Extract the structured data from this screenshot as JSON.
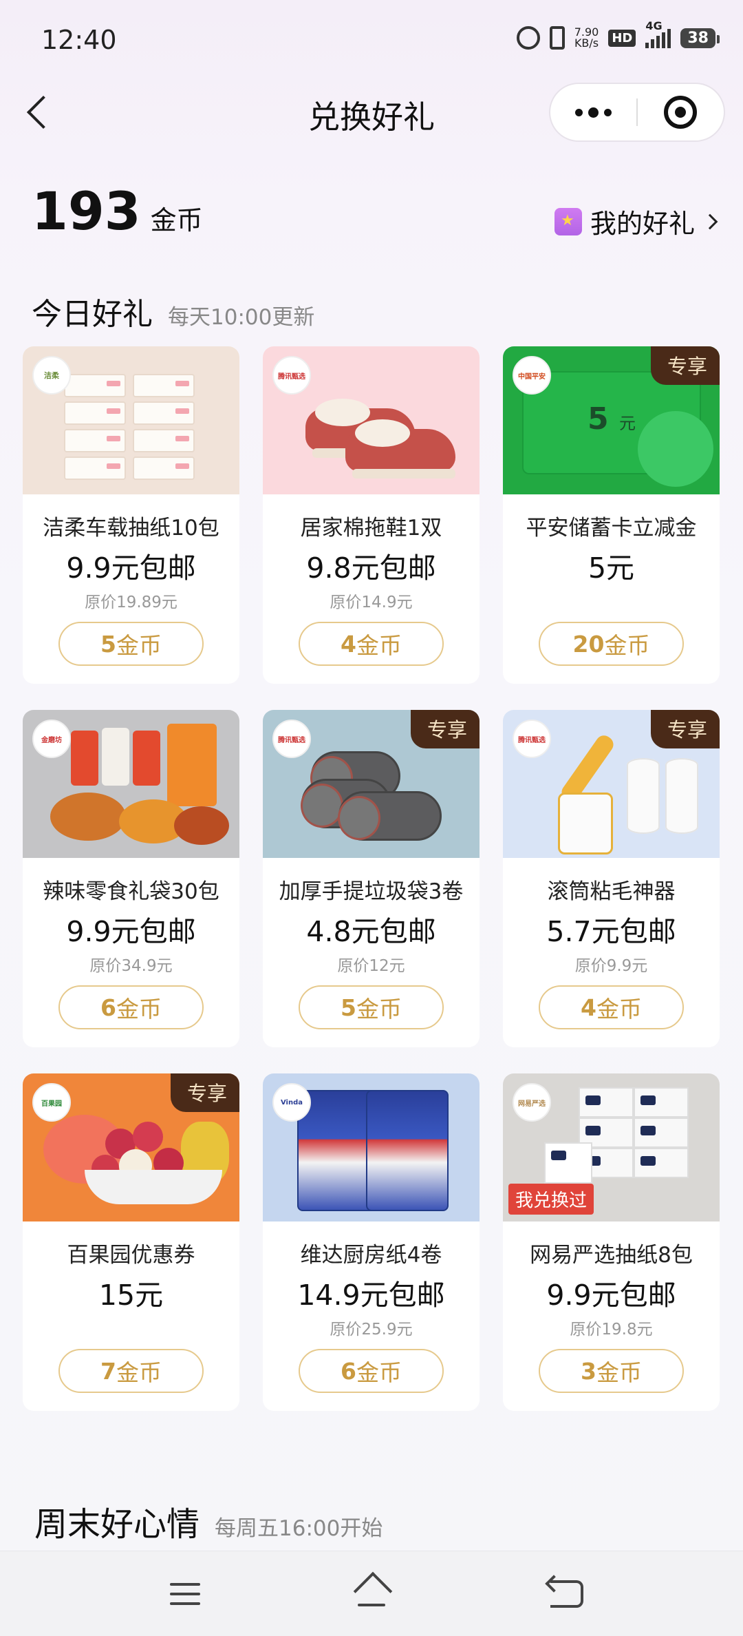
{
  "status_bar": {
    "time": "12:40",
    "speed_value": "7.90",
    "speed_unit": "KB/s",
    "hd": "HD",
    "network": "4G",
    "battery": "38"
  },
  "nav": {
    "title": "兑换好礼"
  },
  "wallet": {
    "coins": "193",
    "coins_unit": "金币",
    "my_gifts_label": "我的好礼"
  },
  "today": {
    "title": "今日好礼",
    "subtitle": "每天10:00更新",
    "items": [
      {
        "name": "洁柔车载抽纸10包",
        "price": "9.9元包邮",
        "original": "原价19.89元",
        "coins": "5",
        "coin_unit": "金币",
        "tag": "",
        "image": "tissue-packs",
        "brand": "洁柔"
      },
      {
        "name": "居家棉拖鞋1双",
        "price": "9.8元包邮",
        "original": "原价14.9元",
        "coins": "4",
        "coin_unit": "金币",
        "tag": "",
        "image": "cotton-slippers",
        "brand": "腾讯甄选"
      },
      {
        "name": "平安储蓄卡立减金",
        "price": "5元",
        "original": "",
        "coins": "20",
        "coin_unit": "金币",
        "tag": "专享",
        "image": "green-coupon-card",
        "brand": "中国平安",
        "card_amount": "5",
        "card_unit": "元"
      },
      {
        "name": "辣味零食礼袋30包",
        "price": "9.9元包邮",
        "original": "原价34.9元",
        "coins": "6",
        "coin_unit": "金币",
        "tag": "",
        "image": "spicy-snacks",
        "brand": "金磨坊"
      },
      {
        "name": "加厚手提垃圾袋3卷",
        "price": "4.8元包邮",
        "original": "原价12元",
        "coins": "5",
        "coin_unit": "金币",
        "tag": "专享",
        "image": "garbage-bag-rolls",
        "brand": "腾讯甄选"
      },
      {
        "name": "滚筒粘毛神器",
        "price": "5.7元包邮",
        "original": "原价9.9元",
        "coins": "4",
        "coin_unit": "金币",
        "tag": "专享",
        "image": "lint-roller",
        "brand": "腾讯甄选"
      },
      {
        "name": "百果园优惠券",
        "price": "15元",
        "original": "",
        "coins": "7",
        "coin_unit": "金币",
        "tag": "专享",
        "image": "fruit-platter",
        "brand": "百果园"
      },
      {
        "name": "维达厨房纸4卷",
        "price": "14.9元包邮",
        "original": "原价25.9元",
        "coins": "6",
        "coin_unit": "金币",
        "tag": "",
        "image": "kitchen-paper",
        "brand": "Vinda"
      },
      {
        "name": "网易严选抽纸8包",
        "price": "9.9元包邮",
        "original": "原价19.8元",
        "coins": "3",
        "coin_unit": "金币",
        "tag": "我兑换过",
        "image": "tissue-packs-2",
        "brand": "网易严选"
      }
    ]
  },
  "weekend": {
    "title": "周末好心情",
    "subtitle": "每周五16:00开始"
  },
  "colors": {
    "accent_gold": "#c99a40",
    "exclusive_tag_bg": "#4a2a18",
    "redeemed_tag_bg": "#e0443a"
  }
}
